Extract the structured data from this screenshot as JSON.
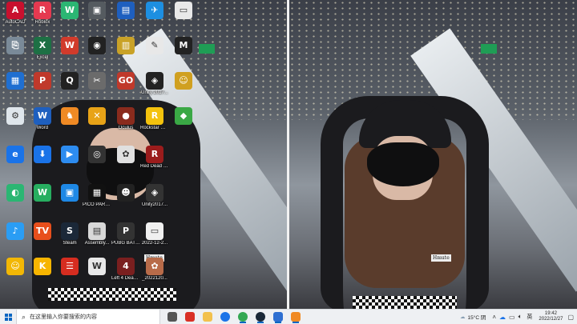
{
  "desktop_icons": [
    {
      "label": "AutoCAD",
      "color": "#c8102e",
      "glyph": "A",
      "icon": "autocad-icon"
    },
    {
      "label": "Roblox",
      "color": "#e53950",
      "glyph": "R",
      "icon": "app-icon"
    },
    {
      "label": "",
      "color": "#2bb673",
      "glyph": "W",
      "icon": "wechat-icon"
    },
    {
      "label": "",
      "color": "#555b60",
      "glyph": "▣",
      "icon": "game-icon"
    },
    {
      "label": "",
      "color": "#1e5fbf",
      "glyph": "▤",
      "icon": "app-icon"
    },
    {
      "label": "",
      "color": "#1d8fe1",
      "glyph": "✈",
      "icon": "app-icon"
    },
    {
      "label": "",
      "color": "#e9e9e9",
      "glyph": "▭",
      "icon": "file-icon"
    },
    {
      "label": "",
      "color": "#7a8a98",
      "glyph": "⎘",
      "icon": "file-icon"
    },
    {
      "label": "Excel",
      "color": "#1d7044",
      "glyph": "X",
      "icon": "excel-icon"
    },
    {
      "label": "",
      "color": "#d13b2b",
      "glyph": "W",
      "icon": "wps-icon"
    },
    {
      "label": "",
      "color": "#222",
      "glyph": "◉",
      "icon": "app-icon"
    },
    {
      "label": "",
      "color": "#c9a227",
      "glyph": "▥",
      "icon": "folder-icon"
    },
    {
      "label": "",
      "color": "#e8e8e8",
      "glyph": "✎",
      "icon": "file-icon"
    },
    {
      "label": "",
      "color": "#222",
      "glyph": "M",
      "icon": "game-icon"
    },
    {
      "label": "",
      "color": "#1f6fd1",
      "glyph": "▦",
      "icon": "computer-icon"
    },
    {
      "label": "",
      "color": "#c0392b",
      "glyph": "P",
      "icon": "powerpoint-icon"
    },
    {
      "label": "",
      "color": "#222",
      "glyph": "Q",
      "icon": "qq-icon"
    },
    {
      "label": "",
      "color": "#6b6b6b",
      "glyph": "✂",
      "icon": "app-icon"
    },
    {
      "label": "",
      "color": "#c0392b",
      "glyph": "GO",
      "icon": "app-icon"
    },
    {
      "label": "Unity 2017...",
      "color": "#222",
      "glyph": "◈",
      "icon": "unity-icon"
    },
    {
      "label": "",
      "color": "#d0a020",
      "glyph": "☺",
      "icon": "game-icon"
    },
    {
      "label": "",
      "color": "#dfe6ec",
      "glyph": "⚙",
      "icon": "control-panel-icon"
    },
    {
      "label": "Word",
      "color": "#1e5fbf",
      "glyph": "W",
      "icon": "word-icon"
    },
    {
      "label": "",
      "color": "#f08a24",
      "glyph": "♞",
      "icon": "app-icon"
    },
    {
      "label": "",
      "color": "#e8a317",
      "glyph": "✕",
      "icon": "app-icon"
    },
    {
      "label": "Oculus",
      "color": "#8a2b1d",
      "glyph": "●",
      "icon": "game-icon"
    },
    {
      "label": "Rockstar Games",
      "color": "#f4c20d",
      "glyph": "R",
      "icon": "rockstar-icon"
    },
    {
      "label": "",
      "color": "#3aa845",
      "glyph": "◆",
      "icon": "app-icon"
    },
    {
      "label": "",
      "color": "#1a73e8",
      "glyph": "e",
      "icon": "edge-icon"
    },
    {
      "label": "",
      "color": "#1a73e8",
      "glyph": "⬇",
      "icon": "app-icon"
    },
    {
      "label": "",
      "color": "#2d8cf0",
      "glyph": "▶",
      "icon": "app-icon"
    },
    {
      "label": "",
      "color": "#333",
      "glyph": "◎",
      "icon": "app-icon"
    },
    {
      "label": "",
      "color": "#e0e0e0",
      "glyph": "✿",
      "icon": "app-icon"
    },
    {
      "label": "Red Dead Redempti...",
      "color": "#9b1c1c",
      "glyph": "R",
      "icon": "game-icon"
    },
    {
      "label": "",
      "color": "",
      "glyph": "",
      "icon": "empty"
    },
    {
      "label": "",
      "color": "#2bb673",
      "glyph": "◐",
      "icon": "app-icon"
    },
    {
      "label": "",
      "color": "#27ae60",
      "glyph": "W",
      "icon": "wechat-icon"
    },
    {
      "label": "",
      "color": "#1e88e5",
      "glyph": "▣",
      "icon": "app-icon"
    },
    {
      "label": "PICO PARKClass...",
      "color": "#111",
      "glyph": "▦",
      "icon": "game-icon"
    },
    {
      "label": "",
      "color": "#222",
      "glyph": "☻",
      "icon": "game-icon"
    },
    {
      "label": "Unity2017...",
      "color": "#333",
      "glyph": "◈",
      "icon": "unity-icon"
    },
    {
      "label": "",
      "color": "",
      "glyph": "",
      "icon": "empty"
    },
    {
      "label": "",
      "color": "#2a9df4",
      "glyph": "♪",
      "icon": "app-icon"
    },
    {
      "label": "",
      "color": "#e84f1c",
      "glyph": "TV",
      "icon": "app-icon"
    },
    {
      "label": "Steam",
      "color": "#1b2838",
      "glyph": "S",
      "icon": "steam-icon"
    },
    {
      "label": "Assembly...",
      "color": "#d8d8d8",
      "glyph": "▤",
      "icon": "file-icon"
    },
    {
      "label": "PUBG BATTLEGR...",
      "color": "#333",
      "glyph": "P",
      "icon": "game-icon"
    },
    {
      "label": "2022-12-2...",
      "color": "#f0f0f0",
      "glyph": "▭",
      "icon": "file-icon"
    },
    {
      "label": "",
      "color": "",
      "glyph": "",
      "icon": "empty"
    },
    {
      "label": "",
      "color": "#f2b705",
      "glyph": "☺",
      "icon": "app-icon"
    },
    {
      "label": "",
      "color": "#f7b500",
      "glyph": "K",
      "icon": "app-icon"
    },
    {
      "label": "",
      "color": "#d62d20",
      "glyph": "☰",
      "icon": "app-icon"
    },
    {
      "label": "",
      "color": "#e8e8e8",
      "glyph": "W",
      "icon": "word-icon"
    },
    {
      "label": "Left 4 Dead 2",
      "color": "#7a1f1f",
      "glyph": "4",
      "icon": "game-icon"
    },
    {
      "label": "_2022120...",
      "color": "#b86b49",
      "glyph": "✿",
      "icon": "image-file-icon"
    },
    {
      "label": "",
      "color": "",
      "glyph": "",
      "icon": "empty"
    }
  ],
  "wallpaper": {
    "left_badge": "Hmute",
    "right_badge": "Hmute"
  },
  "taskbar": {
    "search_placeholder": "在这里输入你要搜索的内容",
    "apps": [
      {
        "icon": "task-view-icon",
        "color": "#555",
        "active": false
      },
      {
        "icon": "calendar-icon",
        "color": "#d93025",
        "active": false
      },
      {
        "icon": "file-explorer-icon",
        "color": "#f2c14e",
        "active": false
      },
      {
        "icon": "edge-icon",
        "color": "#1a73e8",
        "active": false
      },
      {
        "icon": "chrome-icon",
        "color": "#34a853",
        "active": true
      },
      {
        "icon": "steam-icon",
        "color": "#1b2838",
        "active": true
      },
      {
        "icon": "game-icon",
        "color": "#2e6fd1",
        "active": true
      },
      {
        "icon": "orange-app-icon",
        "color": "#f08a24",
        "active": true
      }
    ],
    "weather": "15°C 阴",
    "language": "英",
    "time": "19:42",
    "date": "2022/12/27"
  }
}
